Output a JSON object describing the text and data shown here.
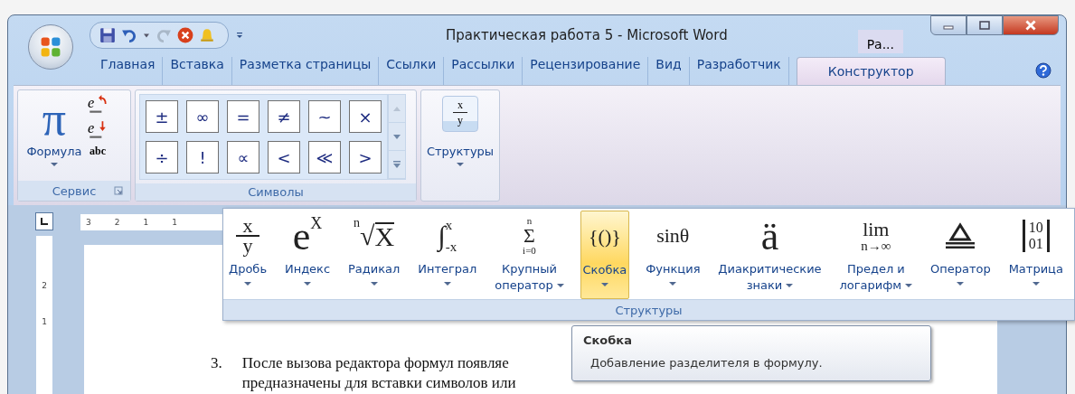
{
  "window": {
    "title": "Практическая работа 5 - Microsoft Word",
    "other_tab": "Ра..."
  },
  "tabs": [
    {
      "label": "Главная",
      "selected": false
    },
    {
      "label": "Вставка",
      "selected": false
    },
    {
      "label": "Разметка страницы",
      "selected": false
    },
    {
      "label": "Ссылки",
      "selected": false
    },
    {
      "label": "Рассылки",
      "selected": false
    },
    {
      "label": "Рецензирование",
      "selected": false
    },
    {
      "label": "Вид",
      "selected": false
    },
    {
      "label": "Разработчик",
      "selected": false
    },
    {
      "label": "Конструктор",
      "selected": true
    }
  ],
  "service_group": {
    "title": "Сервис",
    "formula_button": "Формула",
    "formula_glyph": "π",
    "tool_glyphs": [
      "e",
      "e"
    ],
    "plain_text_button": "abc"
  },
  "symbols_group": {
    "title": "Символы",
    "symbols": [
      "±",
      "∞",
      "=",
      "≠",
      "~",
      "×",
      "÷",
      "!",
      "∝",
      "<",
      "≪",
      ">"
    ]
  },
  "structures_button": {
    "label": "Структуры",
    "icon": [
      "x",
      "y"
    ]
  },
  "ruler": {
    "horizontal": [
      "3",
      "2",
      "1",
      "1"
    ],
    "vertical": [
      "2",
      "1"
    ]
  },
  "structures_menu": {
    "title": "Структуры",
    "items": [
      {
        "lines": [
          "Дробь"
        ],
        "selected": false,
        "icon": {
          "kind": "fraction",
          "parts": [
            "x",
            "y"
          ]
        }
      },
      {
        "lines": [
          "Индекс"
        ],
        "selected": false,
        "icon": {
          "kind": "script",
          "parts": [
            "e",
            "X"
          ]
        }
      },
      {
        "lines": [
          "Радикал"
        ],
        "selected": false,
        "icon": {
          "kind": "radical",
          "parts": [
            "n",
            "√",
            "X"
          ]
        }
      },
      {
        "lines": [
          "Интеграл"
        ],
        "selected": false,
        "icon": {
          "kind": "limits",
          "parts": [
            "∫",
            "x",
            "-x"
          ]
        }
      },
      {
        "lines": [
          "Крупный",
          "оператор"
        ],
        "selected": false,
        "icon": {
          "kind": "stack",
          "parts": [
            "n",
            "Σ",
            "i=0"
          ]
        }
      },
      {
        "lines": [
          "Скобка"
        ],
        "selected": true,
        "icon": {
          "kind": "plain",
          "parts": [
            "{()}"
          ]
        }
      },
      {
        "lines": [
          "Функция"
        ],
        "selected": false,
        "icon": {
          "kind": "plain",
          "parts": [
            "sinθ"
          ]
        }
      },
      {
        "lines": [
          "Диакритические",
          "знаки"
        ],
        "selected": false,
        "icon": {
          "kind": "big",
          "parts": [
            "ä"
          ]
        }
      },
      {
        "lines": [
          "Предел и",
          "логарифм"
        ],
        "selected": false,
        "icon": {
          "kind": "below",
          "parts": [
            "lim",
            "n→∞"
          ]
        }
      },
      {
        "lines": [
          "Оператор"
        ],
        "selected": false,
        "icon": {
          "kind": "operator"
        }
      },
      {
        "lines": [
          "Матрица"
        ],
        "selected": false,
        "icon": {
          "kind": "matrix",
          "parts": [
            "10",
            "01"
          ]
        }
      }
    ]
  },
  "tooltip": {
    "title": "Скобка",
    "text": "Добавление разделителя в формулу."
  },
  "document": {
    "number": "3.",
    "lines": [
      "После вызова редактора формул появляе",
      "предназначены для вставки символов или"
    ]
  }
}
